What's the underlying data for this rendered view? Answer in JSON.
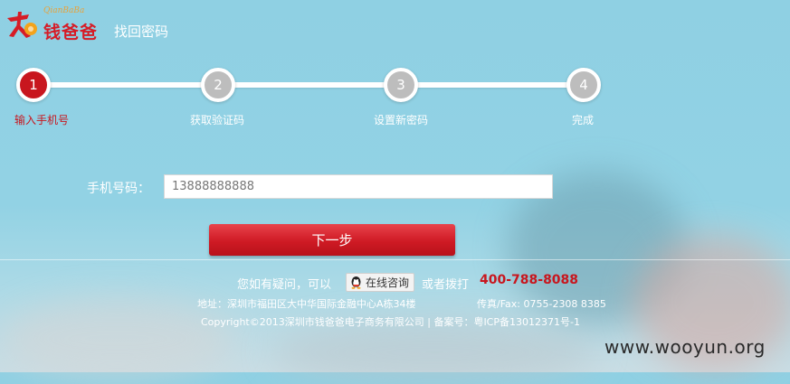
{
  "header": {
    "logo_sub": "QianBaBa",
    "logo_text": "钱爸爸",
    "page_title": "找回密码"
  },
  "steps": [
    {
      "number": "1",
      "label": "输入手机号",
      "state": "active"
    },
    {
      "number": "2",
      "label": "获取验证码",
      "state": "inactive"
    },
    {
      "number": "3",
      "label": "设置新密码",
      "state": "inactive"
    },
    {
      "number": "4",
      "label": "完成",
      "state": "inactive"
    }
  ],
  "form": {
    "phone_label": "手机号码：",
    "phone_value": "13888888888",
    "next_label": "下一步"
  },
  "footer": {
    "help_prefix": "您如有疑问，可以",
    "qq_label": "在线咨询",
    "help_mid": "或者拨打",
    "hotline": "400-788-8088",
    "address": "地址：深圳市福田区大中华国际金融中心A栋34楼",
    "fax": "传真/Fax: 0755-2308 8385",
    "copyright": "Copyright©2013深圳市钱爸爸电子商务有限公司 | 备案号：粤ICP备13012371号-1"
  },
  "watermark": "www.wooyun.org",
  "colors": {
    "accent": "#c8161e",
    "active_step": "#c8161e",
    "inactive_step": "#bdbdbd",
    "background": "#8fd0e3"
  }
}
